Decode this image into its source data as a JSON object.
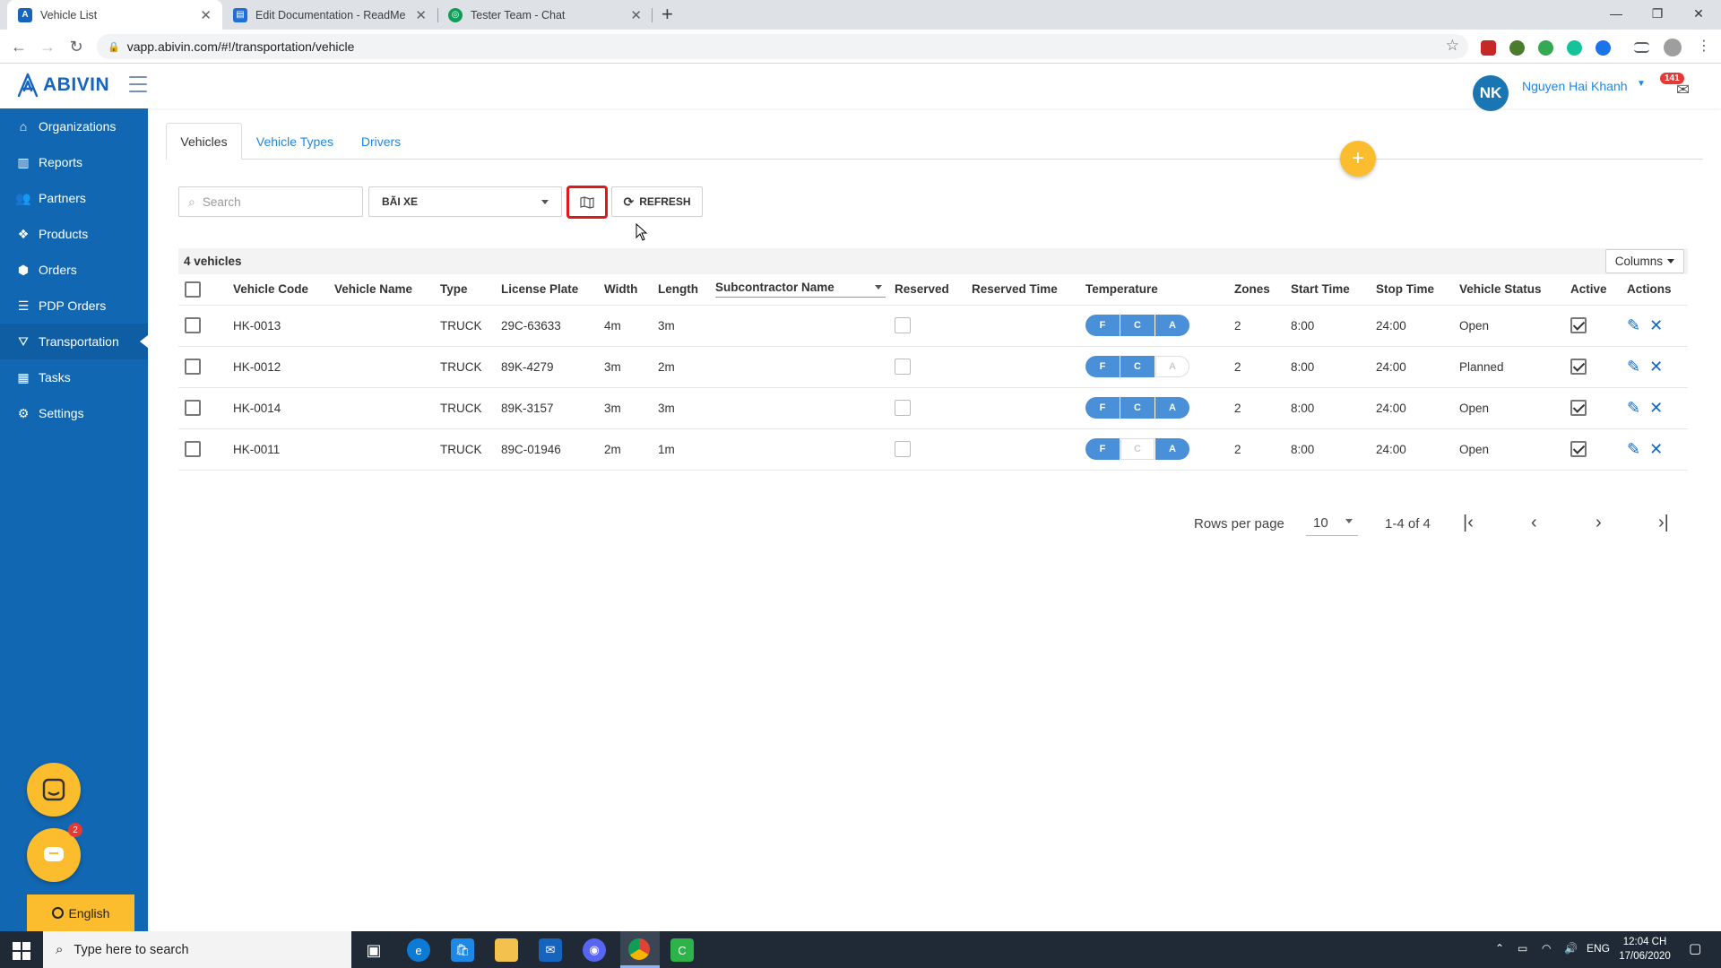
{
  "browser": {
    "tabs": [
      {
        "title": "Vehicle List",
        "color": "#1565c0"
      },
      {
        "title": "Edit Documentation - ReadMe",
        "color": "#1e6fd9"
      },
      {
        "title": "Tester Team - Chat",
        "color": "#0f9d58"
      }
    ],
    "url": "vapp.abivin.com/#!/transportation/vehicle"
  },
  "app": {
    "logo": "ABIVIN",
    "user": {
      "initials": "NK",
      "name": "Nguyen Hai Khanh",
      "mail_count": "141"
    }
  },
  "sidebar": {
    "items": [
      {
        "label": "Organizations",
        "icon": "home-icon"
      },
      {
        "label": "Reports",
        "icon": "bar-chart-icon"
      },
      {
        "label": "Partners",
        "icon": "users-icon"
      },
      {
        "label": "Products",
        "icon": "products-icon"
      },
      {
        "label": "Orders",
        "icon": "cubes-icon"
      },
      {
        "label": "PDP Orders",
        "icon": "list-icon"
      },
      {
        "label": "Transportation",
        "icon": "road-icon",
        "active": true
      },
      {
        "label": "Tasks",
        "icon": "calendar-icon"
      },
      {
        "label": "Settings",
        "icon": "gear-icon"
      }
    ],
    "chat_badge": "2",
    "language": "English"
  },
  "content_tabs": [
    "Vehicles",
    "Vehicle Types",
    "Drivers"
  ],
  "filters": {
    "search_placeholder": "Search",
    "depot": "BÃI XE",
    "refresh_label": "REFRESH"
  },
  "summary": {
    "count_label": "4 vehicles",
    "columns_label": "Columns"
  },
  "table": {
    "headers": [
      "Vehicle Code",
      "Vehicle Name",
      "Type",
      "License Plate",
      "Width",
      "Length",
      "Subcontractor Name",
      "Reserved",
      "Reserved Time",
      "Temperature",
      "Zones",
      "Start Time",
      "Stop Time",
      "Vehicle Status",
      "Active",
      "Actions"
    ],
    "rows": [
      {
        "code": "HK-0013",
        "name": "",
        "type": "TRUCK",
        "plate": "29C-63633",
        "width": "4m",
        "length": "3m",
        "sub": "",
        "reserved": false,
        "reserved_time": "",
        "temp": [
          true,
          true,
          true
        ],
        "zones": "2",
        "start": "8:00",
        "stop": "24:00",
        "status": "Open",
        "active": true
      },
      {
        "code": "HK-0012",
        "name": "",
        "type": "TRUCK",
        "plate": "89K-4279",
        "width": "3m",
        "length": "2m",
        "sub": "",
        "reserved": false,
        "reserved_time": "",
        "temp": [
          true,
          true,
          false
        ],
        "zones": "2",
        "start": "8:00",
        "stop": "24:00",
        "status": "Planned",
        "active": true
      },
      {
        "code": "HK-0014",
        "name": "",
        "type": "TRUCK",
        "plate": "89K-3157",
        "width": "3m",
        "length": "3m",
        "sub": "",
        "reserved": false,
        "reserved_time": "",
        "temp": [
          true,
          true,
          true
        ],
        "zones": "2",
        "start": "8:00",
        "stop": "24:00",
        "status": "Open",
        "active": true
      },
      {
        "code": "HK-0011",
        "name": "",
        "type": "TRUCK",
        "plate": "89C-01946",
        "width": "2m",
        "length": "1m",
        "sub": "",
        "reserved": false,
        "reserved_time": "",
        "temp": [
          true,
          false,
          true
        ],
        "zones": "2",
        "start": "8:00",
        "stop": "24:00",
        "status": "Open",
        "active": true
      }
    ],
    "temp_letters": [
      "F",
      "C",
      "A"
    ]
  },
  "pagination": {
    "rows_per_page_label": "Rows per page",
    "rows_per_page": "10",
    "range": "1-4 of 4"
  },
  "taskbar": {
    "search_placeholder": "Type here to search",
    "lang": "ENG",
    "time": "12:04 CH",
    "date": "17/06/2020"
  }
}
